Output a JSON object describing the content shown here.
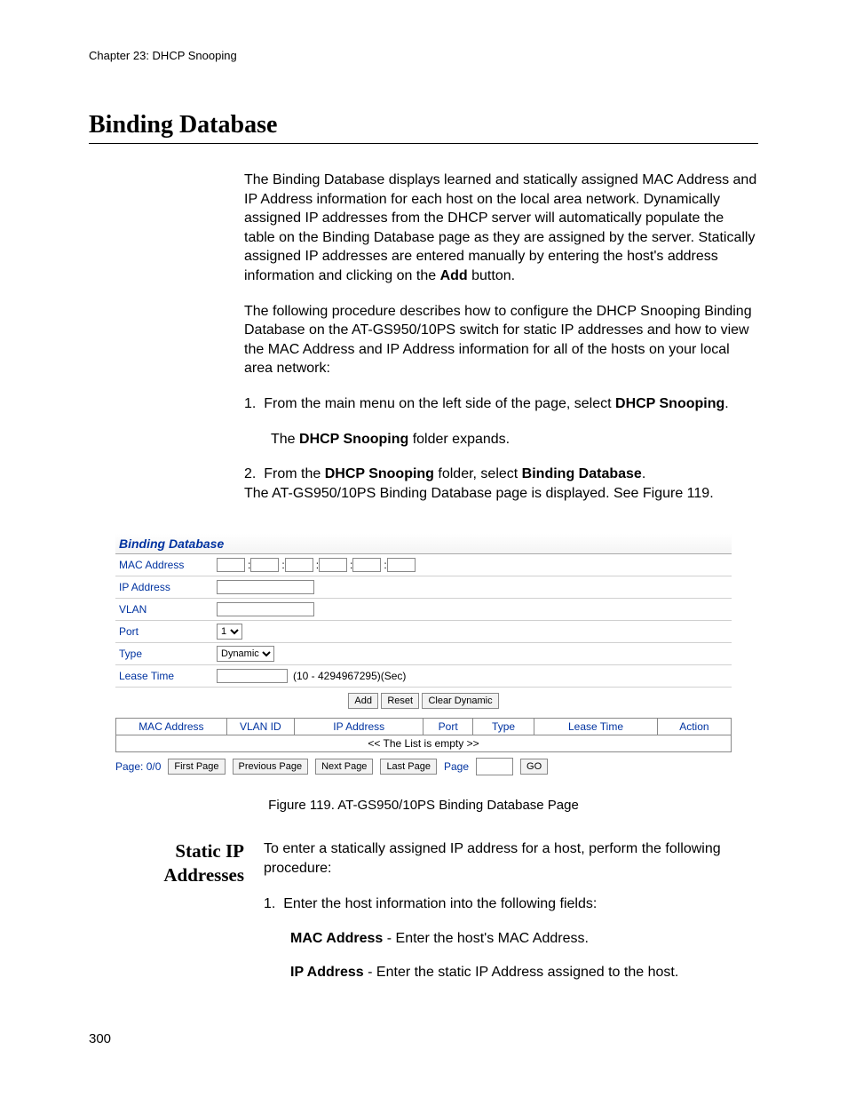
{
  "chapter": "Chapter 23: DHCP Snooping",
  "section_title": "Binding Database",
  "para1": "The Binding Database displays learned and statically assigned MAC Address and IP Address information for each host on the local area network. Dynamically assigned IP addresses from the DHCP server will automatically populate the table on the Binding Database page as they are assigned by the server. Statically assigned IP addresses are entered manually by entering the host's address information and clicking on the ",
  "para1_bold": "Add",
  "para1_tail": " button.",
  "para2": "The following procedure describes how to configure the DHCP Snooping Binding Database on the AT-GS950/10PS switch for static IP addresses and how to view the MAC Address and IP Address information for all of the hosts on your local area network:",
  "step1_prefix": "1.",
  "step1_a": "From the main menu on the left side of the page, select ",
  "step1_bold": "DHCP Snooping",
  "step1_tail": ".",
  "step1_b_pre": "The ",
  "step1_b_bold": "DHCP Snooping",
  "step1_b_post": " folder expands.",
  "step2_prefix": "2.",
  "step2_a": "From the ",
  "step2_bold1": "DHCP Snooping",
  "step2_mid": " folder, select ",
  "step2_bold2": "Binding Database",
  "step2_tail": ".",
  "step2_b": "The AT-GS950/10PS Binding Database page is displayed. See Figure 119.",
  "figure": {
    "title": "Binding Database",
    "labels": {
      "mac": "MAC Address",
      "ip": "IP Address",
      "vlan": "VLAN",
      "port": "Port",
      "type": "Type",
      "lease": "Lease Time"
    },
    "port_value": "1",
    "type_value": "Dynamic",
    "lease_hint": "(10 - 4294967295)(Sec)",
    "buttons": {
      "add": "Add",
      "reset": "Reset",
      "clear": "Clear Dynamic"
    },
    "table": {
      "headers": [
        "MAC Address",
        "VLAN ID",
        "IP Address",
        "Port",
        "Type",
        "Lease Time",
        "Action"
      ],
      "empty": "<< The List is empty >>"
    },
    "pager": {
      "status": "Page: 0/0",
      "first": "First Page",
      "prev": "Previous Page",
      "next": "Next Page",
      "last": "Last Page",
      "page_label": "Page",
      "go": "GO"
    },
    "caption": "Figure 119. AT-GS950/10PS Binding Database Page"
  },
  "static": {
    "heading_l1": "Static IP",
    "heading_l2": "Addresses",
    "intro": "To enter a statically assigned IP address for a host, perform the following procedure:",
    "step1_prefix": "1.",
    "step1": "Enter the host information into the following fields:",
    "mac_bold": "MAC Address",
    "mac_rest": " - Enter the host's MAC Address.",
    "ip_bold": "IP Address",
    "ip_rest": " - Enter the static IP Address assigned to the host."
  },
  "page_number": "300"
}
